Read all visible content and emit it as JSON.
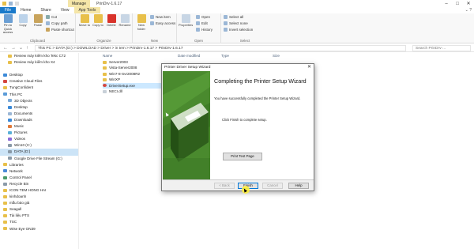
{
  "window": {
    "manage_tab": "Manage",
    "title": "PrinDrv-1.6.17"
  },
  "ribbon_tabs": [
    "File",
    "Home",
    "Share",
    "View",
    "App Tools"
  ],
  "ribbon": {
    "clipboard": {
      "pin": "Pin to Quick access",
      "copy": "Copy",
      "paste": "Paste",
      "cut": "Cut",
      "copy_path": "Copy path",
      "paste_shortcut": "Paste shortcut",
      "label": "Clipboard"
    },
    "organize": {
      "move_to": "Move to",
      "copy_to": "Copy to",
      "delete": "Delete",
      "rename": "Rename",
      "label": "Organize"
    },
    "new": {
      "new_folder": "New folder",
      "new_item": "New item",
      "easy_access": "Easy access",
      "label": "New"
    },
    "open": {
      "properties": "Properties",
      "open": "Open",
      "edit": "Edit",
      "history": "History",
      "label": "Open"
    },
    "select": {
      "select_all": "Select all",
      "select_none": "Select none",
      "invert_selection": "Invert selection",
      "label": "Select"
    }
  },
  "address": {
    "path": "This PC  >  DATA (D:)  >  DOWLOAD  >  Driver  >  in tem  >  PrinDrv-1.6.17  >  PrinDrv-1.6.17",
    "search_placeholder": "Search PrinDrv-..."
  },
  "sidebar": [
    {
      "label": "Review máy kiểm kho Tekc C72",
      "indent": 1,
      "icon": "folder-icon"
    },
    {
      "label": "Review máy kiểm kho X4",
      "indent": 1,
      "icon": "folder-icon"
    },
    {
      "label": "",
      "indent": 0,
      "icon": ""
    },
    {
      "label": "Desktop",
      "indent": 0,
      "icon": "desktop-icon"
    },
    {
      "label": "Creative Cloud Files",
      "indent": 0,
      "icon": "cloud-icon"
    },
    {
      "label": "TungConfident",
      "indent": 0,
      "icon": "user-icon"
    },
    {
      "label": "This PC",
      "indent": 0,
      "icon": "computer-icon"
    },
    {
      "label": "3D Objects",
      "indent": 1,
      "icon": "cube-icon"
    },
    {
      "label": "Desktop",
      "indent": 1,
      "icon": "desktop-icon"
    },
    {
      "label": "Documents",
      "indent": 1,
      "icon": "document-icon"
    },
    {
      "label": "Downloads",
      "indent": 1,
      "icon": "download-icon"
    },
    {
      "label": "Music",
      "indent": 1,
      "icon": "music-icon"
    },
    {
      "label": "Pictures",
      "indent": 1,
      "icon": "picture-icon"
    },
    {
      "label": "Videos",
      "indent": 1,
      "icon": "video-icon"
    },
    {
      "label": "Win10 (C:)",
      "indent": 1,
      "icon": "drive-icon"
    },
    {
      "label": "DATA (D:)",
      "indent": 1,
      "icon": "drive-icon",
      "selected": true
    },
    {
      "label": "Google Drive File Stream (G:)",
      "indent": 1,
      "icon": "drive-icon"
    },
    {
      "label": "Libraries",
      "indent": 0,
      "icon": "library-icon"
    },
    {
      "label": "Network",
      "indent": 0,
      "icon": "network-icon"
    },
    {
      "label": "Control Panel",
      "indent": 0,
      "icon": "control-panel-icon"
    },
    {
      "label": "Recycle Bin",
      "indent": 0,
      "icon": "recycle-bin-icon"
    },
    {
      "label": "ICON TEM HONG HAI",
      "indent": 0,
      "icon": "folder-icon"
    },
    {
      "label": "kinhdoanh",
      "indent": 0,
      "icon": "folder-icon"
    },
    {
      "label": "mẫu báo giá",
      "indent": 0,
      "icon": "folder-icon"
    },
    {
      "label": "Seagull",
      "indent": 0,
      "icon": "folder-icon"
    },
    {
      "label": "Tài liệu PTS",
      "indent": 0,
      "icon": "folder-icon"
    },
    {
      "label": "TSC",
      "indent": 0,
      "icon": "folder-icon"
    },
    {
      "label": "Wise Eye ON39",
      "indent": 0,
      "icon": "folder-icon"
    }
  ],
  "columns": {
    "name": "Name",
    "date_modified": "Date modified",
    "type": "Type",
    "size": "Size"
  },
  "files": [
    {
      "name": "Server2003",
      "icon": "folder-icon"
    },
    {
      "name": "Vista-Server2008",
      "icon": "folder-icon"
    },
    {
      "name": "Win7-8-Svr2008R2",
      "icon": "folder-icon"
    },
    {
      "name": "WinXP",
      "icon": "folder-icon"
    },
    {
      "name": "DriverSetup.exe",
      "icon": "setup-exe-icon",
      "selected": true
    },
    {
      "name": "NECI.dll",
      "icon": "dll-file-icon"
    }
  ],
  "dialog": {
    "title": "Printer Driver Setup Wizard",
    "heading": "Completing the Printer Setup Wizard",
    "message": "You have successfully completed the Printer Setup Wizard.",
    "finish_hint": "Click Finish to complete setup.",
    "test_page_button": "Print Test Page",
    "back_button": "< Back",
    "finish_button": "Finish",
    "cancel_button": "Cancel",
    "help_button": "Help"
  },
  "colors": {
    "file_tab": "#1979ca",
    "manage_tab": "#f5e6a8",
    "wizard_green": "#4a8a2e",
    "selection": "#cce8ff",
    "cursor_highlight": "#ffef3a"
  }
}
